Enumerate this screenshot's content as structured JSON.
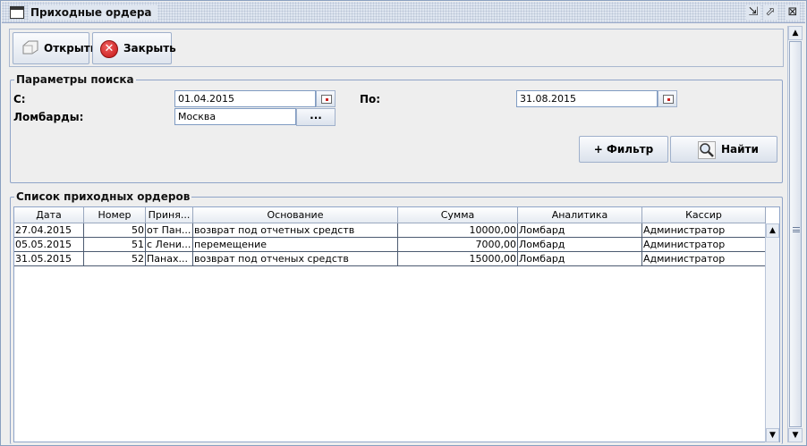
{
  "window": {
    "title": "Приходные ордера",
    "icons": [
      "window-icon",
      "minimize-icon",
      "maximize-icon",
      "close-icon"
    ],
    "controls": {
      "minimize": "⇲",
      "maximize": "⬀",
      "close": "⊠"
    }
  },
  "toolbar": {
    "open_label": "Открыть",
    "close_label": "Закрыть"
  },
  "search": {
    "title": "Параметры поиска",
    "from_label": "С:",
    "from_value": "01.04.2015",
    "to_label": "По:",
    "to_value": "31.08.2015",
    "lombards_label": "Ломбарды:",
    "lombards_value": "Москва",
    "browse_label": "...",
    "filter_label": "+ Фильтр",
    "find_label": "Найти"
  },
  "list": {
    "title": "Список приходных ордеров",
    "columns": [
      "Дата",
      "Номер",
      "Приня...",
      "Основание",
      "Сумма",
      "Аналитика",
      "Кассир"
    ],
    "rows": [
      [
        "27.04.2015",
        "50",
        "от Пан...",
        "возврат под отчетных средств",
        "10000,00",
        "Ломбард",
        "Администратор"
      ],
      [
        "05.05.2015",
        "51",
        "с Лени...",
        "перемещение",
        "7000,00",
        "Ломбард",
        "Администратор"
      ],
      [
        "31.05.2015",
        "52",
        "Панах...",
        "возврат под отченых средств",
        "15000,00",
        "Ломбард",
        "Администратор"
      ]
    ]
  },
  "scroll": {
    "up": "▲",
    "down": "▼"
  },
  "colors": {
    "accent": "#8fa4c8",
    "close_red": "#c41414",
    "title_bar": "#dfe6f0"
  }
}
